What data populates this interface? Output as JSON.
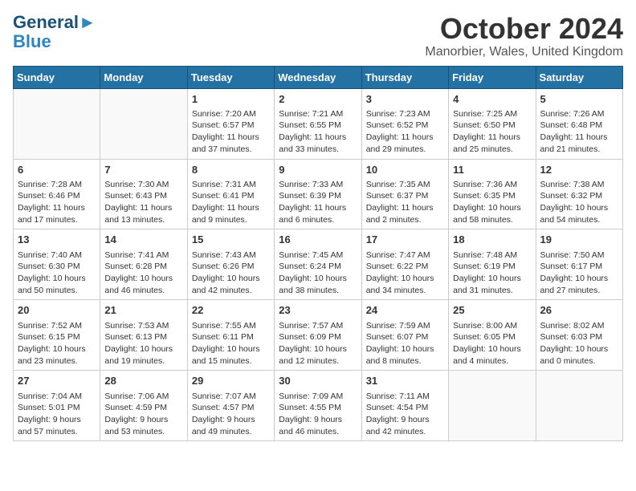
{
  "header": {
    "logo_line1": "General",
    "logo_line2": "Blue",
    "month_title": "October 2024",
    "location": "Manorbier, Wales, United Kingdom"
  },
  "days_of_week": [
    "Sunday",
    "Monday",
    "Tuesday",
    "Wednesday",
    "Thursday",
    "Friday",
    "Saturday"
  ],
  "weeks": [
    [
      {
        "day": "",
        "info": ""
      },
      {
        "day": "",
        "info": ""
      },
      {
        "day": "1",
        "info": "Sunrise: 7:20 AM\nSunset: 6:57 PM\nDaylight: 11 hours\nand 37 minutes."
      },
      {
        "day": "2",
        "info": "Sunrise: 7:21 AM\nSunset: 6:55 PM\nDaylight: 11 hours\nand 33 minutes."
      },
      {
        "day": "3",
        "info": "Sunrise: 7:23 AM\nSunset: 6:52 PM\nDaylight: 11 hours\nand 29 minutes."
      },
      {
        "day": "4",
        "info": "Sunrise: 7:25 AM\nSunset: 6:50 PM\nDaylight: 11 hours\nand 25 minutes."
      },
      {
        "day": "5",
        "info": "Sunrise: 7:26 AM\nSunset: 6:48 PM\nDaylight: 11 hours\nand 21 minutes."
      }
    ],
    [
      {
        "day": "6",
        "info": "Sunrise: 7:28 AM\nSunset: 6:46 PM\nDaylight: 11 hours\nand 17 minutes."
      },
      {
        "day": "7",
        "info": "Sunrise: 7:30 AM\nSunset: 6:43 PM\nDaylight: 11 hours\nand 13 minutes."
      },
      {
        "day": "8",
        "info": "Sunrise: 7:31 AM\nSunset: 6:41 PM\nDaylight: 11 hours\nand 9 minutes."
      },
      {
        "day": "9",
        "info": "Sunrise: 7:33 AM\nSunset: 6:39 PM\nDaylight: 11 hours\nand 6 minutes."
      },
      {
        "day": "10",
        "info": "Sunrise: 7:35 AM\nSunset: 6:37 PM\nDaylight: 11 hours\nand 2 minutes."
      },
      {
        "day": "11",
        "info": "Sunrise: 7:36 AM\nSunset: 6:35 PM\nDaylight: 10 hours\nand 58 minutes."
      },
      {
        "day": "12",
        "info": "Sunrise: 7:38 AM\nSunset: 6:32 PM\nDaylight: 10 hours\nand 54 minutes."
      }
    ],
    [
      {
        "day": "13",
        "info": "Sunrise: 7:40 AM\nSunset: 6:30 PM\nDaylight: 10 hours\nand 50 minutes."
      },
      {
        "day": "14",
        "info": "Sunrise: 7:41 AM\nSunset: 6:28 PM\nDaylight: 10 hours\nand 46 minutes."
      },
      {
        "day": "15",
        "info": "Sunrise: 7:43 AM\nSunset: 6:26 PM\nDaylight: 10 hours\nand 42 minutes."
      },
      {
        "day": "16",
        "info": "Sunrise: 7:45 AM\nSunset: 6:24 PM\nDaylight: 10 hours\nand 38 minutes."
      },
      {
        "day": "17",
        "info": "Sunrise: 7:47 AM\nSunset: 6:22 PM\nDaylight: 10 hours\nand 34 minutes."
      },
      {
        "day": "18",
        "info": "Sunrise: 7:48 AM\nSunset: 6:19 PM\nDaylight: 10 hours\nand 31 minutes."
      },
      {
        "day": "19",
        "info": "Sunrise: 7:50 AM\nSunset: 6:17 PM\nDaylight: 10 hours\nand 27 minutes."
      }
    ],
    [
      {
        "day": "20",
        "info": "Sunrise: 7:52 AM\nSunset: 6:15 PM\nDaylight: 10 hours\nand 23 minutes."
      },
      {
        "day": "21",
        "info": "Sunrise: 7:53 AM\nSunset: 6:13 PM\nDaylight: 10 hours\nand 19 minutes."
      },
      {
        "day": "22",
        "info": "Sunrise: 7:55 AM\nSunset: 6:11 PM\nDaylight: 10 hours\nand 15 minutes."
      },
      {
        "day": "23",
        "info": "Sunrise: 7:57 AM\nSunset: 6:09 PM\nDaylight: 10 hours\nand 12 minutes."
      },
      {
        "day": "24",
        "info": "Sunrise: 7:59 AM\nSunset: 6:07 PM\nDaylight: 10 hours\nand 8 minutes."
      },
      {
        "day": "25",
        "info": "Sunrise: 8:00 AM\nSunset: 6:05 PM\nDaylight: 10 hours\nand 4 minutes."
      },
      {
        "day": "26",
        "info": "Sunrise: 8:02 AM\nSunset: 6:03 PM\nDaylight: 10 hours\nand 0 minutes."
      }
    ],
    [
      {
        "day": "27",
        "info": "Sunrise: 7:04 AM\nSunset: 5:01 PM\nDaylight: 9 hours\nand 57 minutes."
      },
      {
        "day": "28",
        "info": "Sunrise: 7:06 AM\nSunset: 4:59 PM\nDaylight: 9 hours\nand 53 minutes."
      },
      {
        "day": "29",
        "info": "Sunrise: 7:07 AM\nSunset: 4:57 PM\nDaylight: 9 hours\nand 49 minutes."
      },
      {
        "day": "30",
        "info": "Sunrise: 7:09 AM\nSunset: 4:55 PM\nDaylight: 9 hours\nand 46 minutes."
      },
      {
        "day": "31",
        "info": "Sunrise: 7:11 AM\nSunset: 4:54 PM\nDaylight: 9 hours\nand 42 minutes."
      },
      {
        "day": "",
        "info": ""
      },
      {
        "day": "",
        "info": ""
      }
    ]
  ]
}
